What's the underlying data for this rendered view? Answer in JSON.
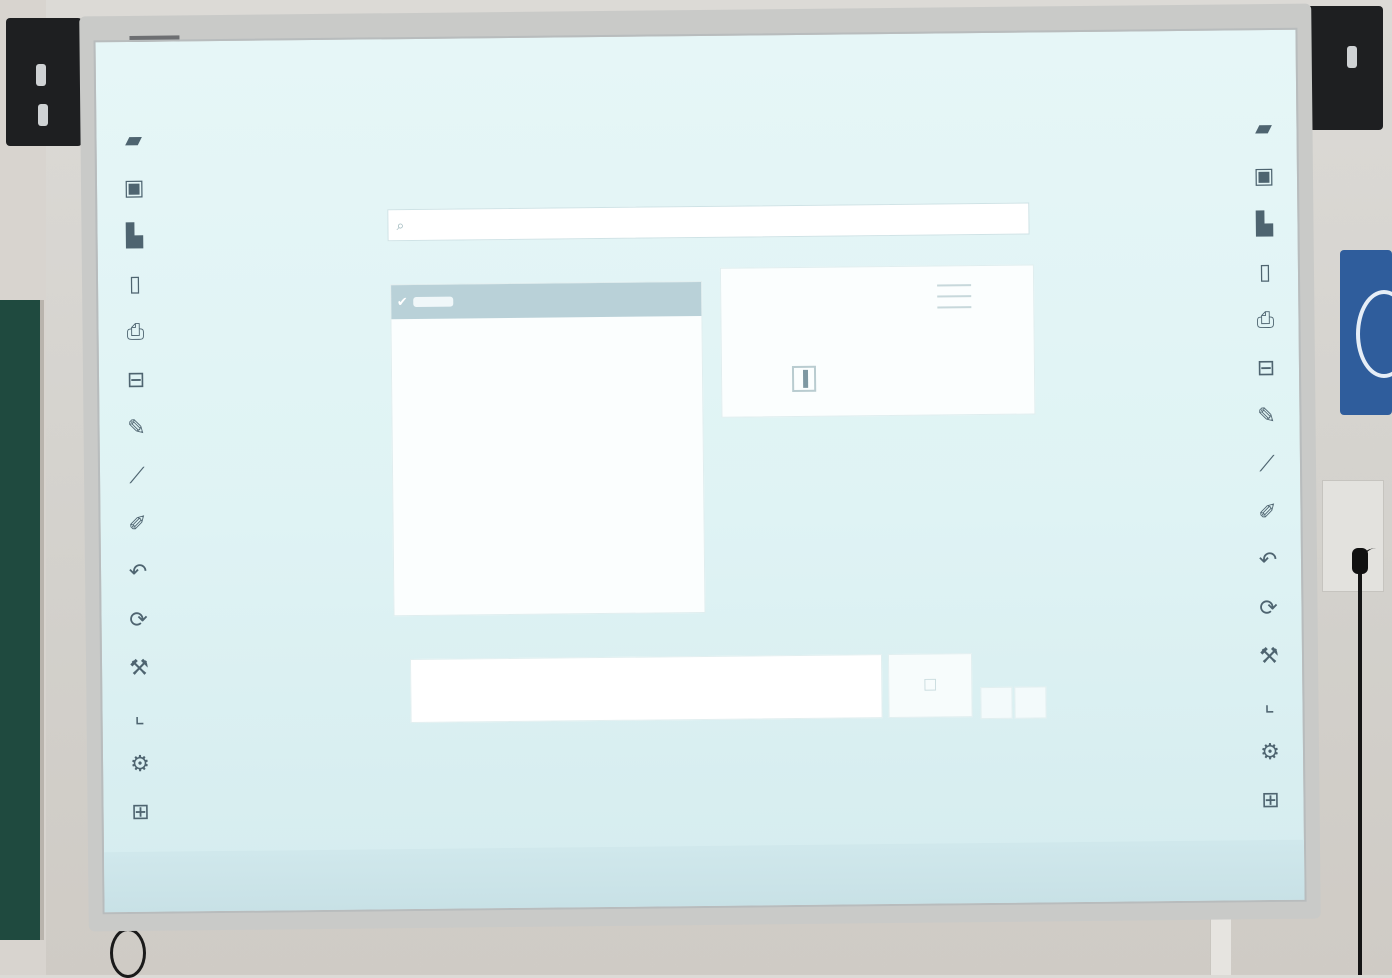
{
  "search": {
    "placeholder": "",
    "button_label": ""
  },
  "left_panel": {
    "heading": "",
    "items": [
      {
        "label": "",
        "checked": true
      }
    ]
  },
  "preview": {
    "heading": ""
  },
  "footer": {
    "link": "",
    "right_label": ""
  },
  "toolbar": {
    "left_icons": [
      "board-icon",
      "save-icon",
      "page-icon",
      "new-page-icon",
      "print-icon",
      "scan-icon",
      "pen-icon",
      "line-icon",
      "marker-icon",
      "eraser-icon",
      "rotate-icon",
      "tools-icon",
      "corner-icon",
      "settings-icon",
      "grid-icon"
    ],
    "right_icons": [
      "board-icon",
      "save-icon",
      "page-icon",
      "new-page-icon",
      "print-icon",
      "scan-icon",
      "pen-icon",
      "line-icon",
      "marker-icon",
      "eraser-icon",
      "rotate-icon",
      "tools-icon",
      "corner-icon",
      "settings-icon",
      "grid-icon"
    ]
  }
}
